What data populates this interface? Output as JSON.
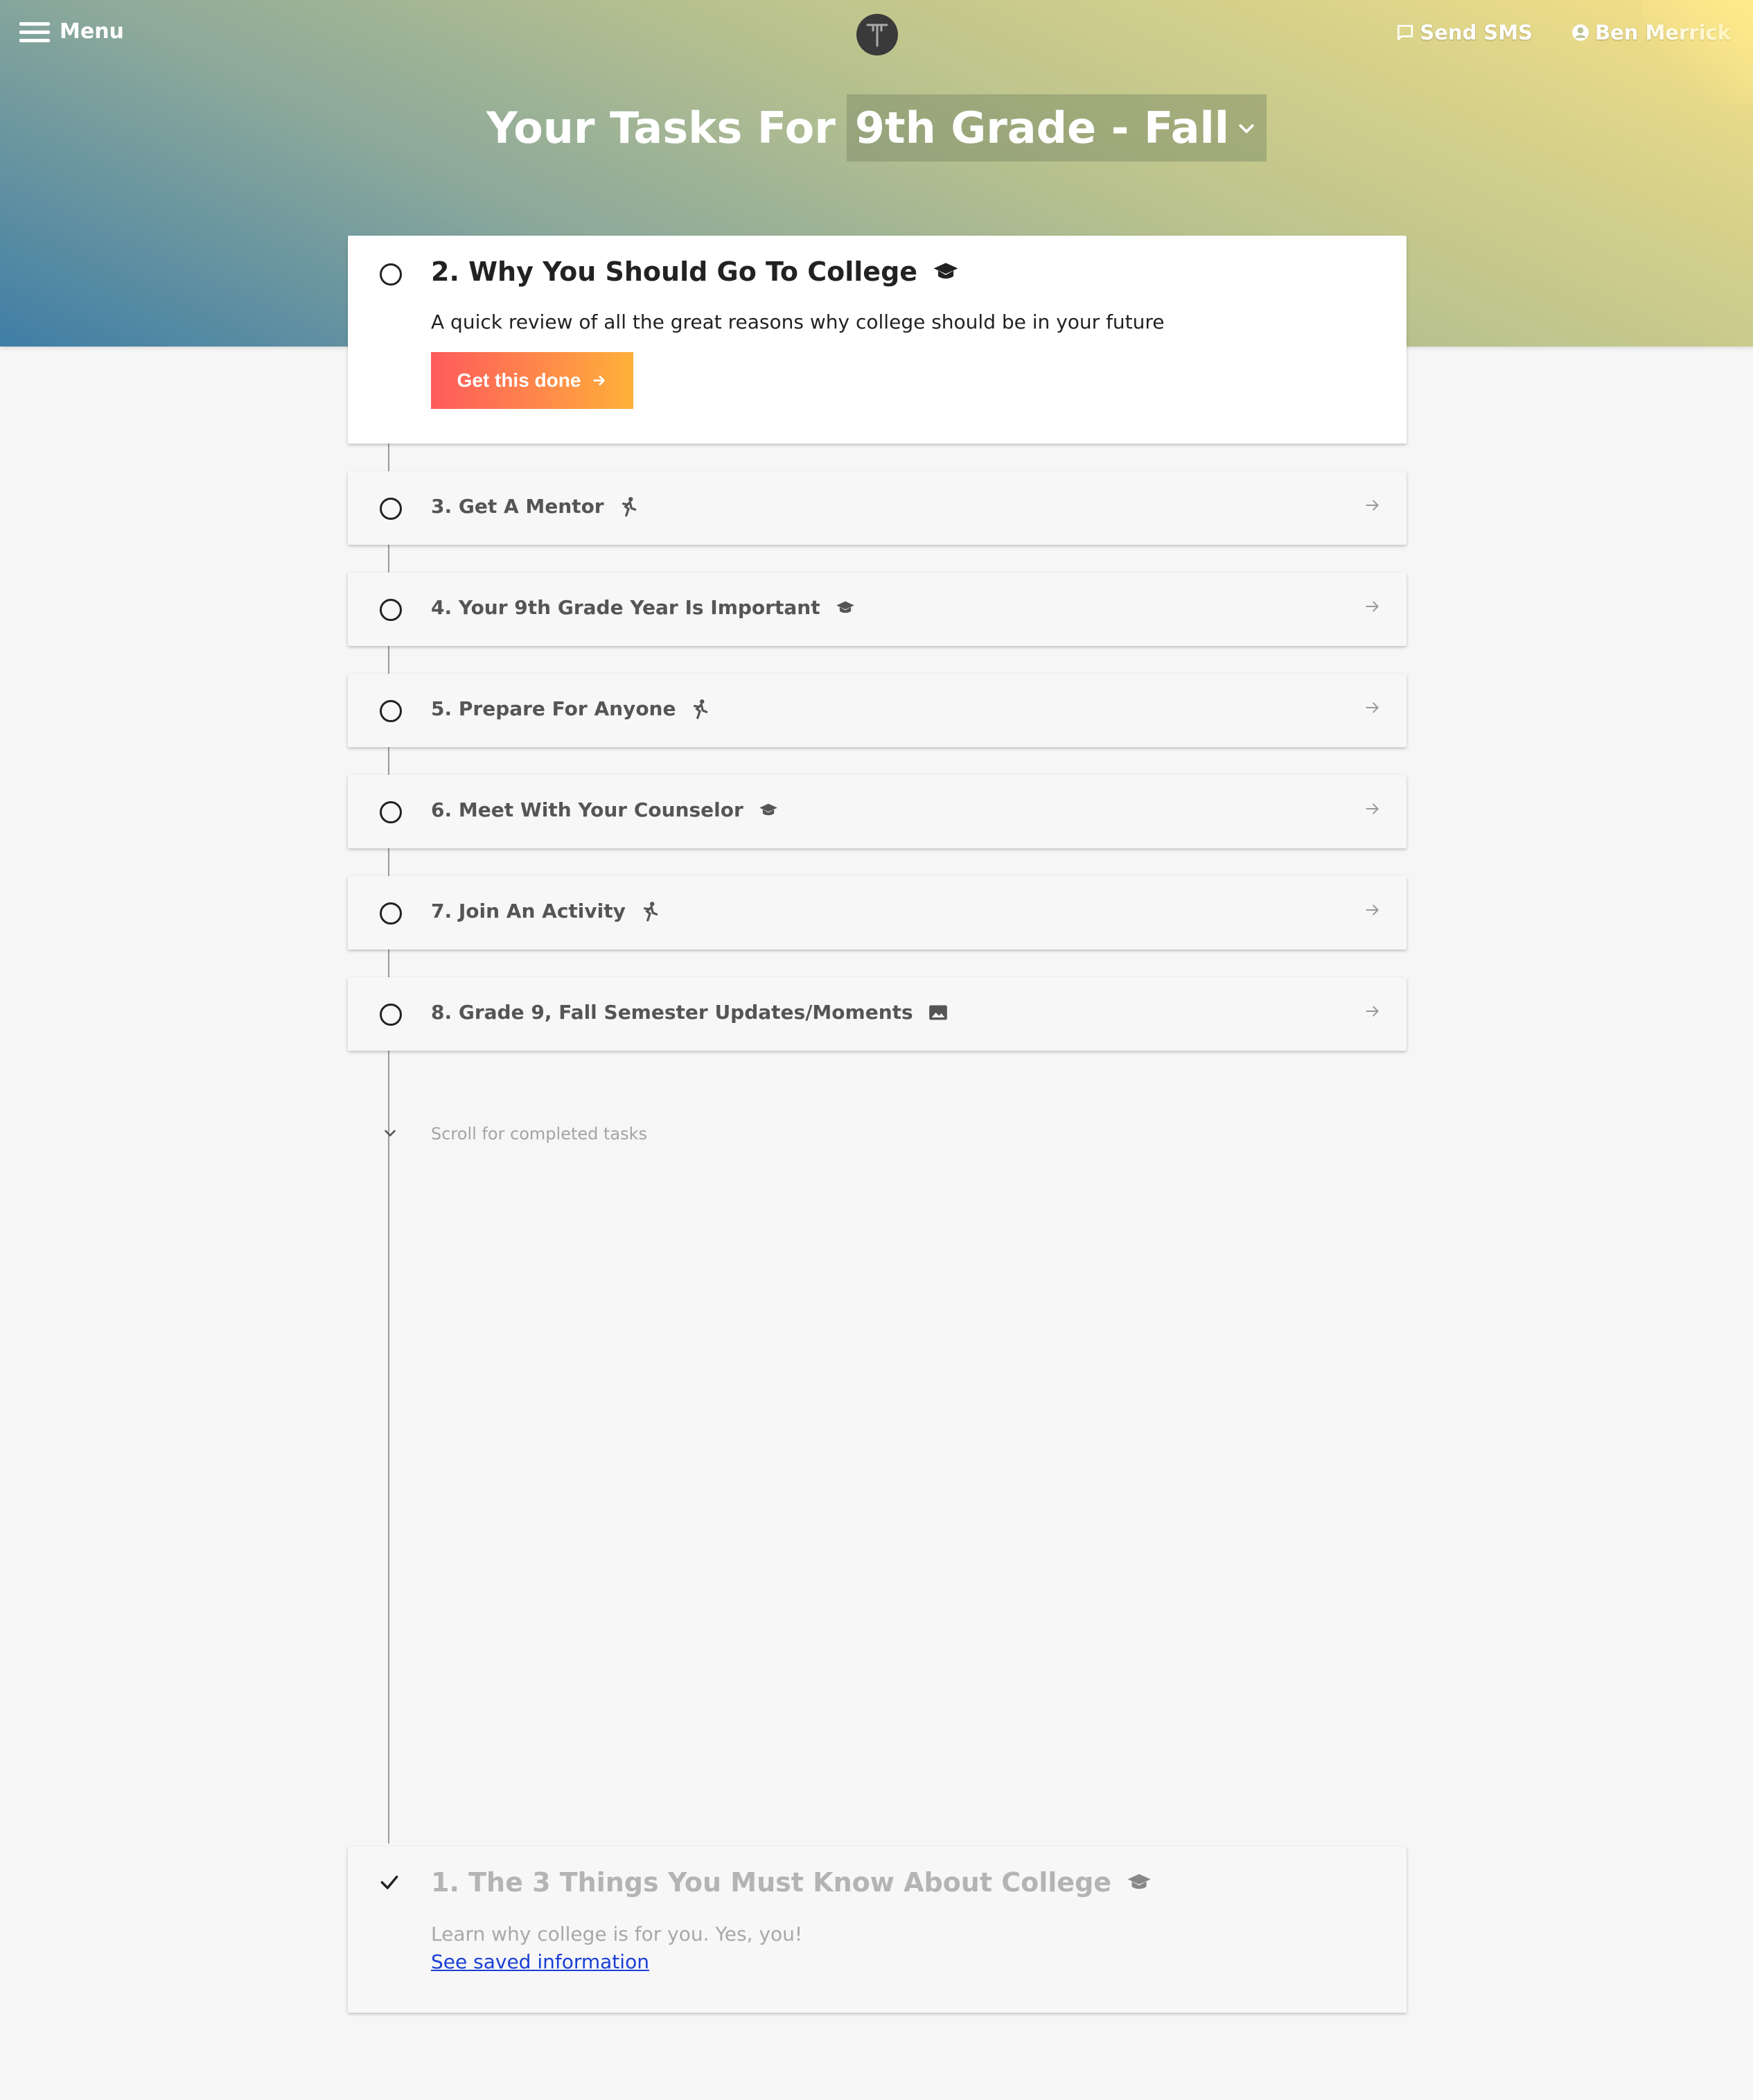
{
  "header": {
    "menu_label": "Menu",
    "send_sms_label": "Send SMS",
    "user_name": "Ben Merrick"
  },
  "heading": {
    "prefix": "Your Tasks For",
    "selected_period": "9th Grade - Fall"
  },
  "active_task": {
    "title": "2. Why You Should Go To College",
    "icon": "graduation-cap-icon",
    "description": "A quick review of all the great reasons why college should be in your future",
    "cta_label": "Get this done"
  },
  "tasks": [
    {
      "title": "3. Get A Mentor",
      "icon": "running-person-icon"
    },
    {
      "title": "4. Your 9th Grade Year Is Important",
      "icon": "graduation-cap-icon"
    },
    {
      "title": "5. Prepare For Anyone",
      "icon": "running-person-icon"
    },
    {
      "title": "6. Meet With Your Counselor",
      "icon": "graduation-cap-icon"
    },
    {
      "title": "7. Join An Activity",
      "icon": "running-person-icon"
    },
    {
      "title": "8. Grade 9, Fall Semester Updates/Moments",
      "icon": "image-icon"
    }
  ],
  "scroll_hint": "Scroll for completed tasks",
  "completed_task": {
    "title": "1. The 3 Things You Must Know About College",
    "icon": "graduation-cap-icon",
    "description": "Learn why college is for you. Yes, you!",
    "link_label": "See saved information"
  },
  "colors": {
    "cta_start": "#fe5a5c",
    "cta_end": "#feb03a",
    "link": "#1a3fd6"
  }
}
